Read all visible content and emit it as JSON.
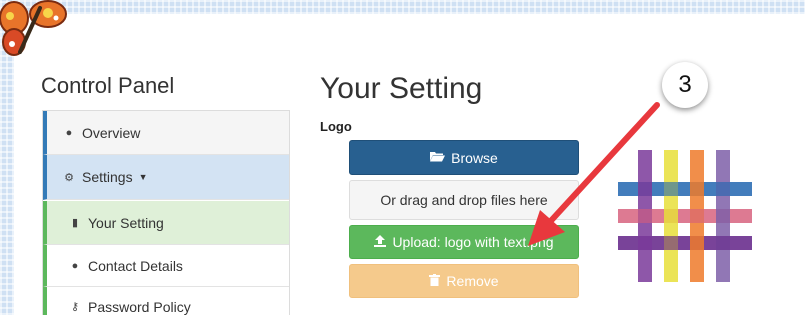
{
  "sidebar": {
    "title": "Control Panel",
    "items": [
      {
        "label": "Overview",
        "icon": "info-circle-icon"
      },
      {
        "label": "Settings",
        "icon": "gear-icon"
      },
      {
        "label": "Your Setting",
        "icon": "file-icon"
      },
      {
        "label": "Contact Details",
        "icon": "speech-bubble-icon"
      },
      {
        "label": "Password Policy",
        "icon": "key-icon"
      }
    ]
  },
  "main": {
    "title": "Your Setting",
    "logo_label": "Logo",
    "browse_label": "Browse",
    "drop_text": "Or drag and drop files here",
    "upload_label": "Upload: logo with text.png",
    "remove_label": "Remove"
  },
  "annotation": {
    "step_number": "3"
  },
  "colors": {
    "primary": "#286090",
    "success": "#5cb85c",
    "warning": "#f5ca8c",
    "nav_active": "#d3e3f3",
    "subnav_active": "#dff0d8",
    "annotation_arrow": "#e8383d"
  }
}
